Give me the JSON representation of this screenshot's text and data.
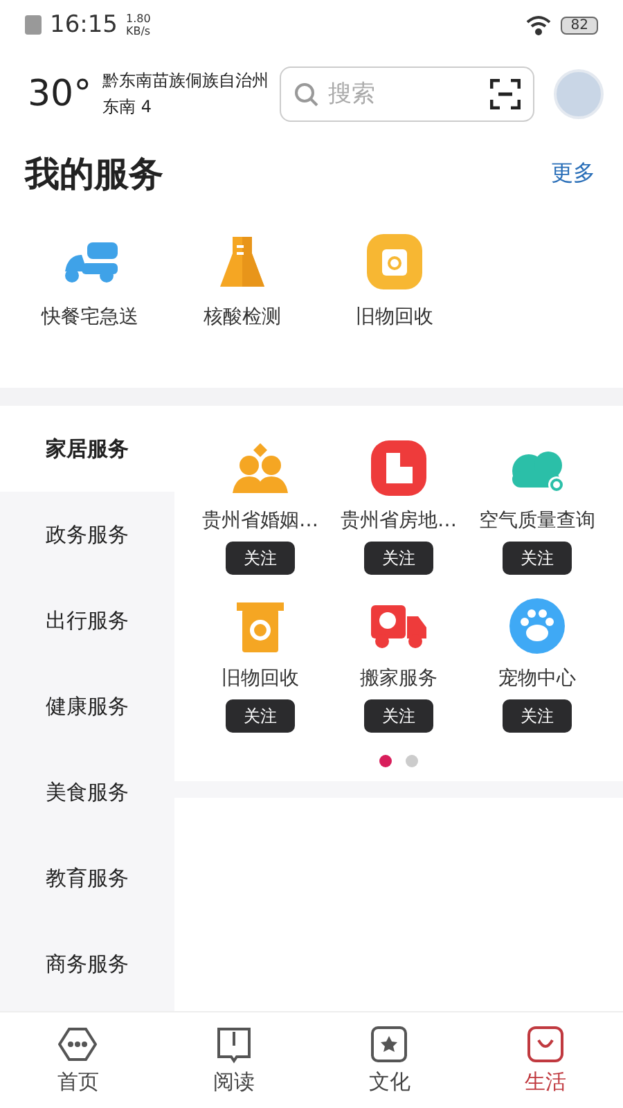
{
  "status_bar": {
    "time": "16:15",
    "speed_value": "1.80",
    "speed_unit": "KB/s",
    "battery": "82"
  },
  "header": {
    "temperature": "30°",
    "location": "黔东南苗族侗族自治州",
    "wind": "东南  4",
    "search": {
      "placeholder": "搜索"
    }
  },
  "my_services": {
    "title": "我的服务",
    "more": "更多",
    "items": [
      {
        "label": "快餐宅急送"
      },
      {
        "label": "核酸检测"
      },
      {
        "label": "旧物回收"
      }
    ]
  },
  "categories": [
    {
      "label": "家居服务",
      "selected": true
    },
    {
      "label": "政务服务",
      "selected": false
    },
    {
      "label": "出行服务",
      "selected": false
    },
    {
      "label": "健康服务",
      "selected": false
    },
    {
      "label": "美食服务",
      "selected": false
    },
    {
      "label": "教育服务",
      "selected": false
    },
    {
      "label": "商务服务",
      "selected": false
    }
  ],
  "services": [
    {
      "label": "贵州省婚姻…",
      "button": "关注"
    },
    {
      "label": "贵州省房地…",
      "button": "关注"
    },
    {
      "label": "空气质量查询",
      "button": "关注"
    },
    {
      "label": "旧物回收",
      "button": "关注"
    },
    {
      "label": "搬家服务",
      "button": "关注"
    },
    {
      "label": "宠物中心",
      "button": "关注"
    }
  ],
  "pager": [
    {
      "selected": true
    },
    {
      "selected": false
    }
  ],
  "bottom_nav": [
    {
      "label": "首页",
      "selected": false
    },
    {
      "label": "阅读",
      "selected": false
    },
    {
      "label": "文化",
      "selected": false
    },
    {
      "label": "生活",
      "selected": true
    }
  ]
}
